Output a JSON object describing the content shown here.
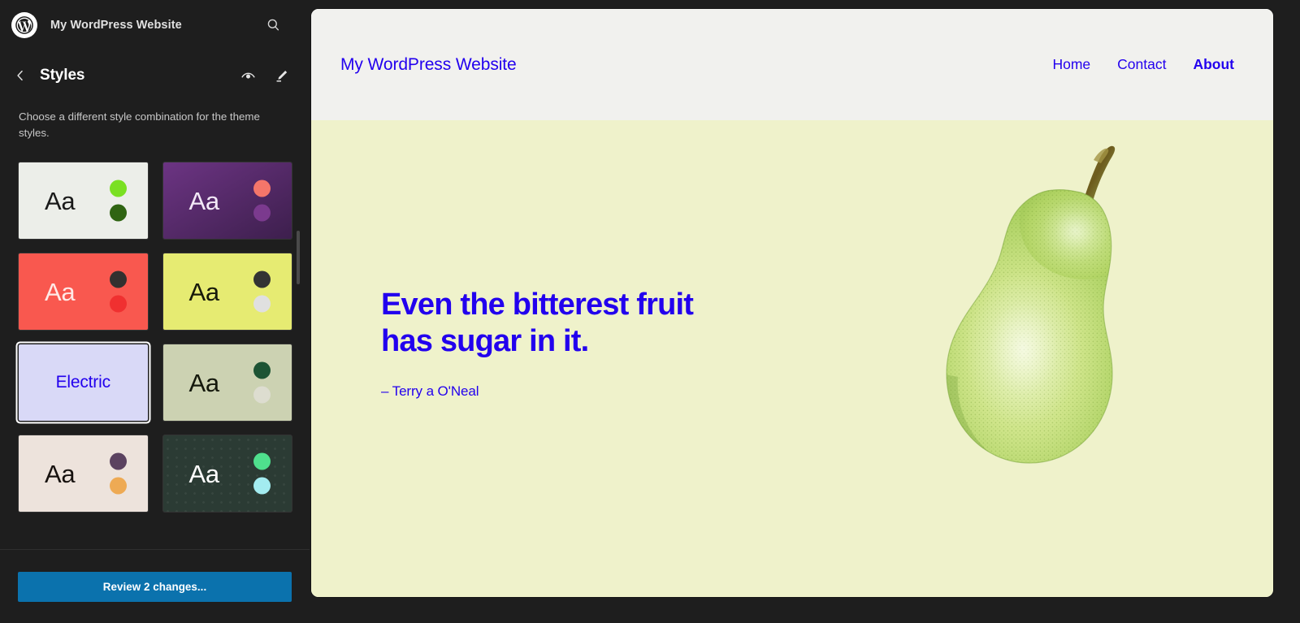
{
  "sidebar": {
    "logo_icon": "wordpress-logo-icon",
    "site_title": "My WordPress Website",
    "search_icon": "search-icon",
    "back_icon": "chevron-left-icon",
    "panel_title": "Styles",
    "actions": [
      {
        "name": "style-book-button",
        "icon": "eye-icon"
      },
      {
        "name": "edit-styles-button",
        "icon": "pencil-icon"
      }
    ],
    "description": "Choose a different style combination for the theme styles.",
    "footer": {
      "review_label": "Review 2 changes..."
    },
    "variations": [
      {
        "name": "variation-default",
        "sample_text": "Aa",
        "selected": false,
        "bg": "#eceee9",
        "text_color": "#1a1a1a",
        "dots": [
          "#7ae022",
          "#2f6412"
        ]
      },
      {
        "name": "variation-purple",
        "sample_text": "Aa",
        "selected": false,
        "bg": "#6c3483",
        "bg2": "#3d1f4d",
        "text_color": "#f3e9f7",
        "dots": [
          "#f4766a",
          "#7b3a8e"
        ]
      },
      {
        "name": "variation-coral",
        "sample_text": "Aa",
        "selected": false,
        "bg": "#f9584f",
        "text_color": "#ffe9e6",
        "dots": [
          "#33302f",
          "#f03030"
        ]
      },
      {
        "name": "variation-lemon",
        "sample_text": "Aa",
        "selected": false,
        "bg": "#e6eb72",
        "text_color": "#17190a",
        "dots": [
          "#333333",
          "#e0e0e0"
        ]
      },
      {
        "name": "variation-electric",
        "sample_text": "Electric",
        "selected": true,
        "bg": "#d9d9f7",
        "text_color": "#2200ee",
        "dots": []
      },
      {
        "name": "variation-sage",
        "sample_text": "Aa",
        "selected": false,
        "bg": "#ccd2b2",
        "text_color": "#14180c",
        "dots": [
          "#1d5434",
          "#ddddd0"
        ]
      },
      {
        "name": "variation-ivory",
        "sample_text": "Aa",
        "selected": false,
        "bg": "#ede3dc",
        "text_color": "#17120f",
        "dots": [
          "#5b4260",
          "#eeaa54"
        ]
      },
      {
        "name": "variation-dark-dots",
        "sample_text": "Aa",
        "selected": false,
        "bg": "#2b3b34",
        "text_color": "#ffffff",
        "dotted": true,
        "dots": [
          "#4fe08d",
          "#a3ecf0"
        ]
      }
    ]
  },
  "preview": {
    "brand": "My WordPress Website",
    "nav": [
      {
        "name": "nav-link-home",
        "label": "Home",
        "current": false
      },
      {
        "name": "nav-link-contact",
        "label": "Contact",
        "current": false
      },
      {
        "name": "nav-link-about",
        "label": "About",
        "current": true
      }
    ],
    "hero": {
      "quote_line_1": "Even the bitterest fruit",
      "quote_line_2": "has sugar in it.",
      "citation": "– Terry a O'Neal",
      "image_icon": "pear-illustration-image",
      "bg_color": "#eff2cb",
      "accent_color": "#2200ee",
      "header_bg": "#f1f1ee"
    }
  }
}
